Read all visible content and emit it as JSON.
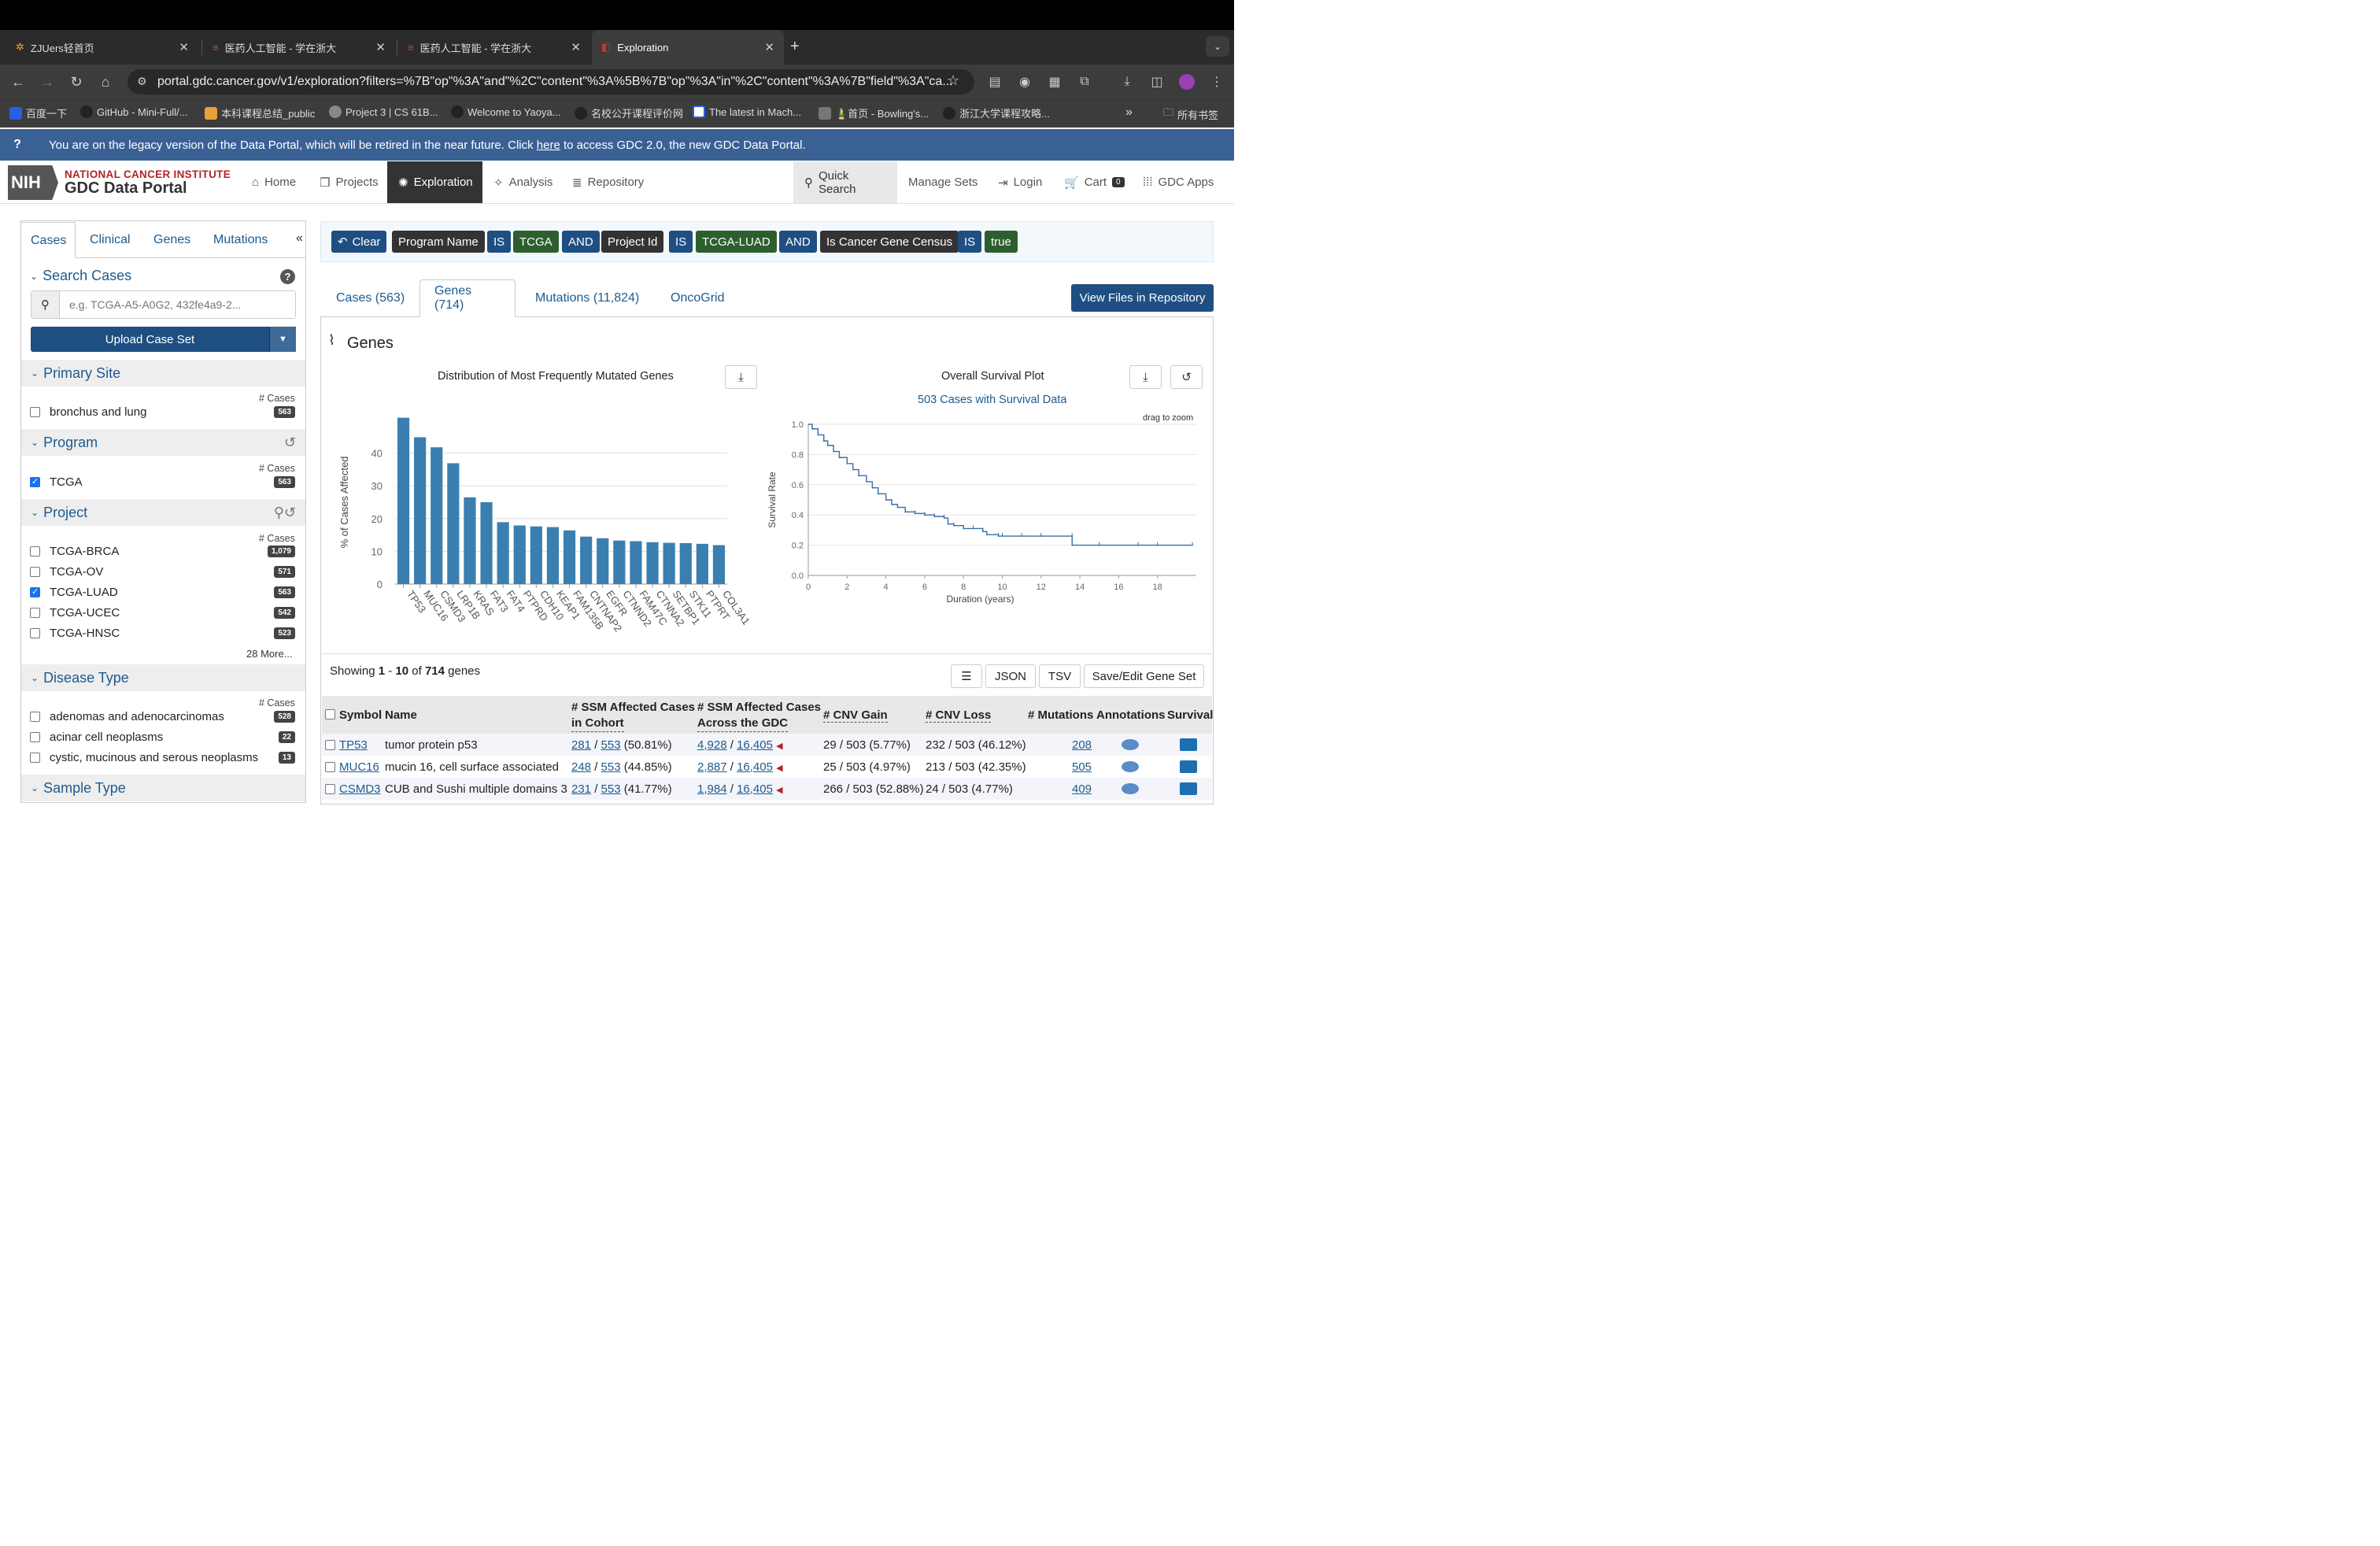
{
  "browser": {
    "tabs": [
      {
        "title": "ZJUers轻首页"
      },
      {
        "title": "医药人工智能 - 学在浙大"
      },
      {
        "title": "医药人工智能 - 学在浙大"
      },
      {
        "title": "Exploration"
      }
    ],
    "url": "portal.gdc.cancer.gov/v1/exploration?filters=%7B\"op\"%3A\"and\"%2C\"content\"%3A%5B%7B\"op\"%3A\"in\"%2C\"content\"%3A%7B\"field\"%3A\"ca...",
    "bookmarks": [
      "百度一下",
      "GitHub - Mini-Full/...",
      "本科课程总结_public",
      "Project 3 | CS 61B...",
      "Welcome to Yaoya...",
      "名校公开课程评价网",
      "The latest in Mach...",
      "🎍首页 - Bowling's...",
      "浙江大学课程攻略..."
    ],
    "bookmarks_folder": "所有书签",
    "overflow": "»"
  },
  "banner": {
    "prefix": "You are on the legacy version of the Data Portal, which will be retired in the near future. Click",
    "link": "here",
    "suffix": "to access GDC 2.0, the new GDC Data Portal."
  },
  "header": {
    "nih": "NIH",
    "nci": "NATIONAL CANCER INSTITUTE",
    "portal": "GDC Data Portal",
    "nav": [
      "Home",
      "Projects",
      "Exploration",
      "Analysis",
      "Repository"
    ],
    "right": {
      "quick_search": "Quick Search",
      "manage_sets": "Manage Sets",
      "login": "Login",
      "cart": "Cart",
      "cart_count": "0",
      "apps": "GDC Apps"
    }
  },
  "sidebar": {
    "tabs": [
      "Cases",
      "Clinical",
      "Genes",
      "Mutations"
    ],
    "collapse": "«",
    "search": {
      "title": "Search Cases",
      "placeholder": "e.g. TCGA-A5-A0G2, 432fe4a9-2...",
      "upload": "Upload Case Set"
    },
    "cases_label": "# Cases",
    "primary_site": {
      "title": "Primary Site",
      "items": [
        {
          "label": "bronchus and lung",
          "count": "563",
          "checked": false
        }
      ]
    },
    "program": {
      "title": "Program",
      "items": [
        {
          "label": "TCGA",
          "count": "563",
          "checked": true
        }
      ]
    },
    "project": {
      "title": "Project",
      "items": [
        {
          "label": "TCGA-BRCA",
          "count": "1,079",
          "checked": false
        },
        {
          "label": "TCGA-OV",
          "count": "571",
          "checked": false
        },
        {
          "label": "TCGA-LUAD",
          "count": "563",
          "checked": true
        },
        {
          "label": "TCGA-UCEC",
          "count": "542",
          "checked": false
        },
        {
          "label": "TCGA-HNSC",
          "count": "523",
          "checked": false
        }
      ],
      "more": "28 More..."
    },
    "disease_type": {
      "title": "Disease Type",
      "items": [
        {
          "label": "adenomas and adenocarcinomas",
          "count": "528",
          "checked": false
        },
        {
          "label": "acinar cell neoplasms",
          "count": "22",
          "checked": false
        },
        {
          "label": "cystic, mucinous and serous neoplasms",
          "count": "13",
          "checked": false
        }
      ]
    },
    "sample_type": {
      "title": "Sample Type"
    }
  },
  "filters": [
    "Clear",
    "Program Name",
    "IS",
    "TCGA",
    "AND",
    "Project Id",
    "IS",
    "TCGA-LUAD",
    "AND",
    "Is Cancer Gene Census",
    "IS",
    "true"
  ],
  "main_tabs": [
    "Cases (563)",
    "Genes (714)",
    "Mutations (11,824)",
    "OncoGrid"
  ],
  "view_files": "View Files in Repository",
  "genes_title": "Genes",
  "bar_title": "Distribution of Most Frequently Mutated Genes",
  "survival": {
    "title": "Overall Survival Plot",
    "subtitle": "503 Cases with Survival Data",
    "drag": "drag to zoom"
  },
  "chart_data": [
    {
      "type": "bar",
      "title": "Distribution of Most Frequently Mutated Genes",
      "xlabel": "",
      "ylabel": "% of Cases Affected",
      "ylim": [
        0,
        50
      ],
      "yticks": [
        0,
        10,
        20,
        30,
        40
      ],
      "categories": [
        "TP53",
        "MUC16",
        "CSMD3",
        "LRP1B",
        "KRAS",
        "FAT3",
        "FAT4",
        "PTPRD",
        "CDH10",
        "KEAP1",
        "FAM135B",
        "CNTNAP2",
        "EGFR",
        "CTNND2",
        "FAM47C",
        "CTNNA2",
        "SETBP1",
        "STK11",
        "PTPRT",
        "COL3A1"
      ],
      "values": [
        50.81,
        44.85,
        41.77,
        36.9,
        26.5,
        25.0,
        18.9,
        17.9,
        17.6,
        17.4,
        16.4,
        14.5,
        14.0,
        13.3,
        13.1,
        12.8,
        12.6,
        12.5,
        12.3,
        11.9
      ],
      "color": "#3a7fb0"
    },
    {
      "type": "line",
      "title": "Overall Survival Plot",
      "xlabel": "Duration (years)",
      "ylabel": "Survival Rate",
      "xlim": [
        0,
        20
      ],
      "ylim": [
        0,
        1.0
      ],
      "xticks": [
        0,
        2,
        4,
        6,
        8,
        10,
        12,
        14,
        16,
        18
      ],
      "yticks": [
        0.0,
        0.2,
        0.4,
        0.6,
        0.8,
        1.0
      ],
      "series": [
        {
          "x": [
            0,
            0.2,
            0.5,
            0.8,
            1,
            1.3,
            1.6,
            2,
            2.3,
            2.6,
            3,
            3.3,
            3.6,
            4,
            4.3,
            4.6,
            5,
            5.5,
            6,
            6.5,
            7,
            7.2,
            7.5,
            8,
            8.5,
            9,
            9.2,
            9.8,
            10,
            11,
            12,
            13.6,
            13.6,
            15,
            17,
            18,
            19.8
          ],
          "y": [
            1.0,
            0.97,
            0.93,
            0.89,
            0.86,
            0.82,
            0.78,
            0.74,
            0.7,
            0.66,
            0.62,
            0.58,
            0.54,
            0.5,
            0.47,
            0.45,
            0.42,
            0.41,
            0.4,
            0.39,
            0.38,
            0.34,
            0.33,
            0.31,
            0.31,
            0.29,
            0.27,
            0.26,
            0.26,
            0.26,
            0.26,
            0.26,
            0.2,
            0.2,
            0.2,
            0.2,
            0.2
          ]
        }
      ],
      "color": "#3a6fa8"
    }
  ],
  "table": {
    "showing": {
      "prefix": "Showing",
      "from": "1",
      "sep": "-",
      "to": "10",
      "of": "of",
      "total": "714",
      "suffix": "genes"
    },
    "buttons": [
      "JSON",
      "TSV",
      "Save/Edit Gene Set"
    ],
    "headers": {
      "symbol": "Symbol",
      "name": "Name",
      "ssm_cohort_1": "# SSM Affected Cases",
      "ssm_cohort_2": "in Cohort",
      "ssm_gdc_1": "# SSM Affected Cases",
      "ssm_gdc_2": "Across the GDC",
      "cnv_gain": "# CNV Gain",
      "cnv_loss": "# CNV Loss",
      "mutations": "# Mutations",
      "annotations": "Annotations",
      "survival": "Survival"
    },
    "rows": [
      {
        "symbol": "TP53",
        "name": "tumor protein p53",
        "c_num": "281",
        "c_den": "553",
        "c_pct": "(50.81%)",
        "g_num": "4,928",
        "g_den": "16,405",
        "gain": "29 / 503 (5.77%)",
        "loss": "232 / 503 (46.12%)",
        "mut": "208"
      },
      {
        "symbol": "MUC16",
        "name": "mucin 16, cell surface associated",
        "c_num": "248",
        "c_den": "553",
        "c_pct": "(44.85%)",
        "g_num": "2,887",
        "g_den": "16,405",
        "gain": "25 / 503 (4.97%)",
        "loss": "213 / 503 (42.35%)",
        "mut": "505"
      },
      {
        "symbol": "CSMD3",
        "name": "CUB and Sushi multiple domains 3",
        "c_num": "231",
        "c_den": "553",
        "c_pct": "(41.77%)",
        "g_num": "1,984",
        "g_den": "16,405",
        "gain": "266 / 503 (52.88%)",
        "loss": "24 / 503 (4.77%)",
        "mut": "409"
      }
    ]
  }
}
